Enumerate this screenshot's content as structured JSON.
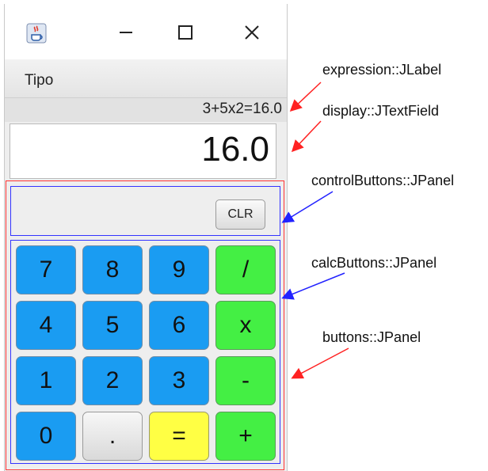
{
  "window": {
    "menu": [
      "Tipo"
    ],
    "expression": "3+5x2=16.0",
    "display": "16.0",
    "clear_label": "CLR",
    "keys": [
      {
        "label": "7",
        "color": "blue"
      },
      {
        "label": "8",
        "color": "blue"
      },
      {
        "label": "9",
        "color": "blue"
      },
      {
        "label": "/",
        "color": "green"
      },
      {
        "label": "4",
        "color": "blue"
      },
      {
        "label": "5",
        "color": "blue"
      },
      {
        "label": "6",
        "color": "blue"
      },
      {
        "label": "x",
        "color": "green"
      },
      {
        "label": "1",
        "color": "blue"
      },
      {
        "label": "2",
        "color": "blue"
      },
      {
        "label": "3",
        "color": "blue"
      },
      {
        "label": "-",
        "color": "green"
      },
      {
        "label": "0",
        "color": "blue"
      },
      {
        "label": ".",
        "color": "white"
      },
      {
        "label": "=",
        "color": "yellow"
      },
      {
        "label": "+",
        "color": "green"
      }
    ],
    "title_buttons": [
      "minimize-icon",
      "maximize-icon",
      "close-icon"
    ],
    "app_icon": "java-cup-icon"
  },
  "annotations": [
    {
      "text": "expression::JLabel",
      "arrow_color": "#ff2222"
    },
    {
      "text": "display::JTextField",
      "arrow_color": "#ff2222"
    },
    {
      "text": "controlButtons::JPanel",
      "arrow_color": "#2222ff"
    },
    {
      "text": "calcButtons::JPanel",
      "arrow_color": "#2222ff"
    },
    {
      "text": "buttons::JPanel",
      "arrow_color": "#ff2222"
    }
  ],
  "colors": {
    "blue_key": "#1a9cf2",
    "green_key": "#44ef44",
    "yellow_key": "#ffff44",
    "panel_red": "#ff3333",
    "panel_blue": "#3333ff"
  }
}
